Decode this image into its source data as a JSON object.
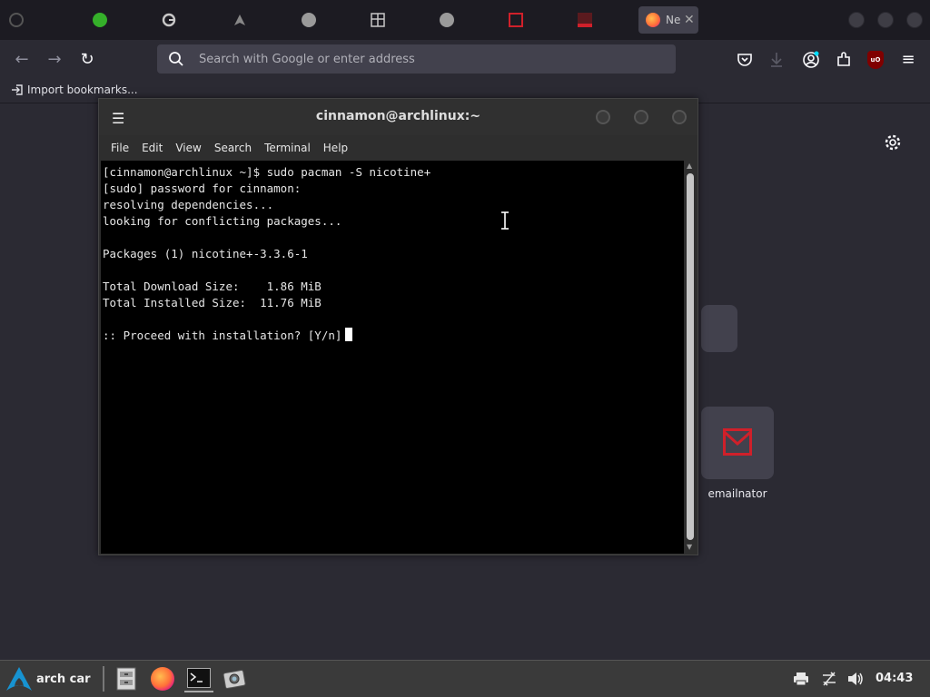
{
  "browser": {
    "tabs": [
      {
        "title": "",
        "icon": "green-face-favicon",
        "color": "#35b02a"
      },
      {
        "title": "",
        "icon": "google-favicon",
        "color": "#c8c8c8"
      },
      {
        "title": "",
        "icon": "archlinux-favicon",
        "color": "#1793d1"
      },
      {
        "title": "",
        "icon": "brain-favicon",
        "color": "#c8c8c8"
      },
      {
        "title": "",
        "icon": "grid-favicon",
        "color": "#c8c8c8"
      },
      {
        "title": "",
        "icon": "brain-favicon",
        "color": "#c8c8c8"
      },
      {
        "title": "",
        "icon": "red-square-favicon",
        "color": "#d0202a"
      },
      {
        "title": "",
        "icon": "red-i-favicon",
        "color": "#d0202a"
      },
      {
        "title": "Ne",
        "icon": "firefox-favicon",
        "color": "#ff7139",
        "active": true
      }
    ],
    "search_placeholder": "Search with Google or enter address",
    "bookmarks": {
      "import_label": "Import bookmarks..."
    },
    "shortcut_tiles": [
      {
        "label": ""
      },
      {
        "label": "emailnator",
        "icon": "envelope-icon",
        "color": "#d0202a"
      }
    ]
  },
  "terminal": {
    "title": "cinnamon@archlinux:~",
    "menu": [
      "File",
      "Edit",
      "View",
      "Search",
      "Terminal",
      "Help"
    ],
    "output": "[cinnamon@archlinux ~]$ sudo pacman -S nicotine+\n[sudo] password for cinnamon:\nresolving dependencies...\nlooking for conflicting packages...\n\nPackages (1) nicotine+-3.3.6-1\n\nTotal Download Size:    1.86 MiB\nTotal Installed Size:  11.76 MiB\n\n:: Proceed with installation? [Y/n]"
  },
  "taskbar": {
    "menu_label": "arch car",
    "apps": [
      "file-manager-icon",
      "firefox-icon",
      "terminal-icon",
      "screenshot-icon"
    ],
    "clock": "04:43"
  },
  "colors": {
    "accent": "#1793d1",
    "alert_red": "#d0202a"
  }
}
